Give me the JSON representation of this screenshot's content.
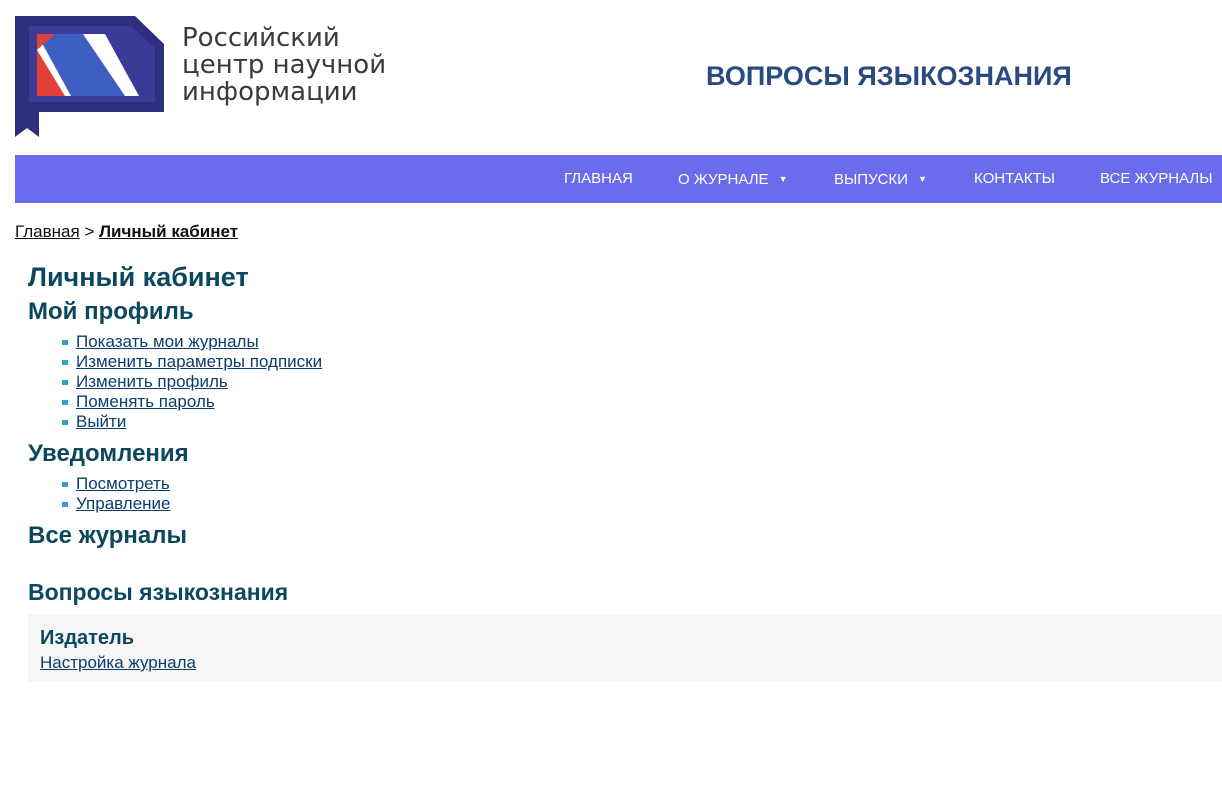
{
  "logo": {
    "lines": [
      "Российский",
      "центр научной",
      "информации"
    ]
  },
  "site_title": "ВОПРОСЫ ЯЗЫКОЗНАНИЯ",
  "nav": {
    "items": [
      {
        "label": "ГЛАВНАЯ"
      },
      {
        "label": "О ЖУРНАЛЕ",
        "dropdown": true
      },
      {
        "label": "ВЫПУСКИ",
        "dropdown": true
      },
      {
        "label": "КОНТАКТЫ"
      },
      {
        "label": "ВСЕ ЖУРНАЛЫ"
      }
    ],
    "caret": "▼"
  },
  "breadcrumb": {
    "home": "Главная",
    "separator": ">",
    "current": "Личный кабинет"
  },
  "page_title": "Личный кабинет",
  "profile": {
    "heading": "Мой профиль",
    "links": [
      "Показать мои журналы",
      "Изменить параметры подписки",
      "Изменить профиль",
      "Поменять пароль",
      "Выйти"
    ]
  },
  "notifications": {
    "heading": "Уведомления",
    "links": [
      "Посмотреть",
      "Управление"
    ]
  },
  "all_journals": {
    "heading": "Все журналы"
  },
  "journal": {
    "heading": "Вопросы языкознания",
    "role": "Издатель",
    "link": "Настройка журнала"
  },
  "colors": {
    "nav_bg": "#6a6cec",
    "heading": "#0b4860",
    "link": "#0b3d6e",
    "site_title": "#2a4b82"
  }
}
